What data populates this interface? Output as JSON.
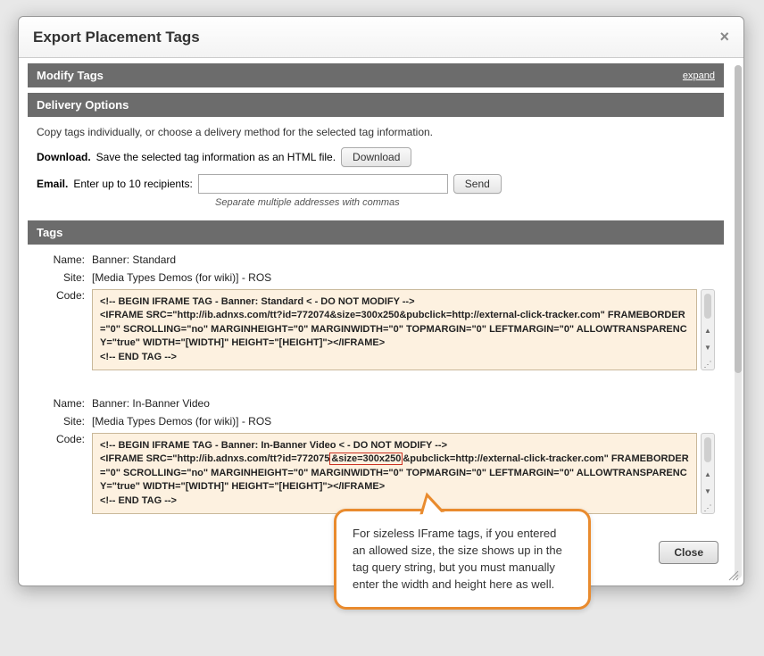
{
  "dialog": {
    "title": "Export Placement Tags",
    "close_btn": "Close"
  },
  "sections": {
    "modify": {
      "title": "Modify Tags",
      "expand": "expand"
    },
    "delivery": {
      "title": "Delivery Options",
      "intro": "Copy tags individually, or choose a delivery method for the selected tag information.",
      "download_label": "Download.",
      "download_text": "Save the selected tag information as an HTML file.",
      "download_btn": "Download",
      "email_label": "Email.",
      "email_text": "Enter up to 10 recipients:",
      "email_hint": "Separate multiple addresses with commas",
      "send_btn": "Send"
    },
    "tags": {
      "title": "Tags"
    }
  },
  "labels": {
    "name": "Name:",
    "site": "Site:",
    "code": "Code:"
  },
  "placements": [
    {
      "name": "Banner: Standard",
      "site": "[Media Types Demos (for wiki)] - ROS",
      "code": "<!-- BEGIN IFRAME TAG - Banner: Standard < - DO NOT MODIFY -->\n<IFRAME SRC=\"http://ib.adnxs.com/tt?id=772074&size=300x250&pubclick=http://external-click-tracker.com\" FRAMEBORDER=\"0\" SCROLLING=\"no\" MARGINHEIGHT=\"0\" MARGINWIDTH=\"0\" TOPMARGIN=\"0\" LEFTMARGIN=\"0\" ALLOWTRANSPARENCY=\"true\" WIDTH=\"[WIDTH]\" HEIGHT=\"[HEIGHT]\"></IFRAME>\n<!-- END TAG -->"
    },
    {
      "name": "Banner: In-Banner Video",
      "site": "[Media Types Demos (for wiki)] - ROS",
      "code_pre": "<!-- BEGIN IFRAME TAG - Banner: In-Banner Video < - DO NOT MODIFY -->\n<IFRAME SRC=\"http://ib.adnxs.com/tt?id=772075",
      "code_hl": "&size=300x250",
      "code_post": "&pubclick=http://external-click-tracker.com\" FRAMEBORDER=\"0\" SCROLLING=\"no\" MARGINHEIGHT=\"0\" MARGINWIDTH=\"0\" TOPMARGIN=\"0\" LEFTMARGIN=\"0\" ALLOWTRANSPARENCY=\"true\" WIDTH=\"[WIDTH]\" HEIGHT=\"[HEIGHT]\"></IFRAME>\n<!-- END TAG -->"
    }
  ],
  "callout": "For sizeless IFrame tags, if you entered an allowed size, the size shows up in the tag query string, but you must manually enter the width and height here as well."
}
